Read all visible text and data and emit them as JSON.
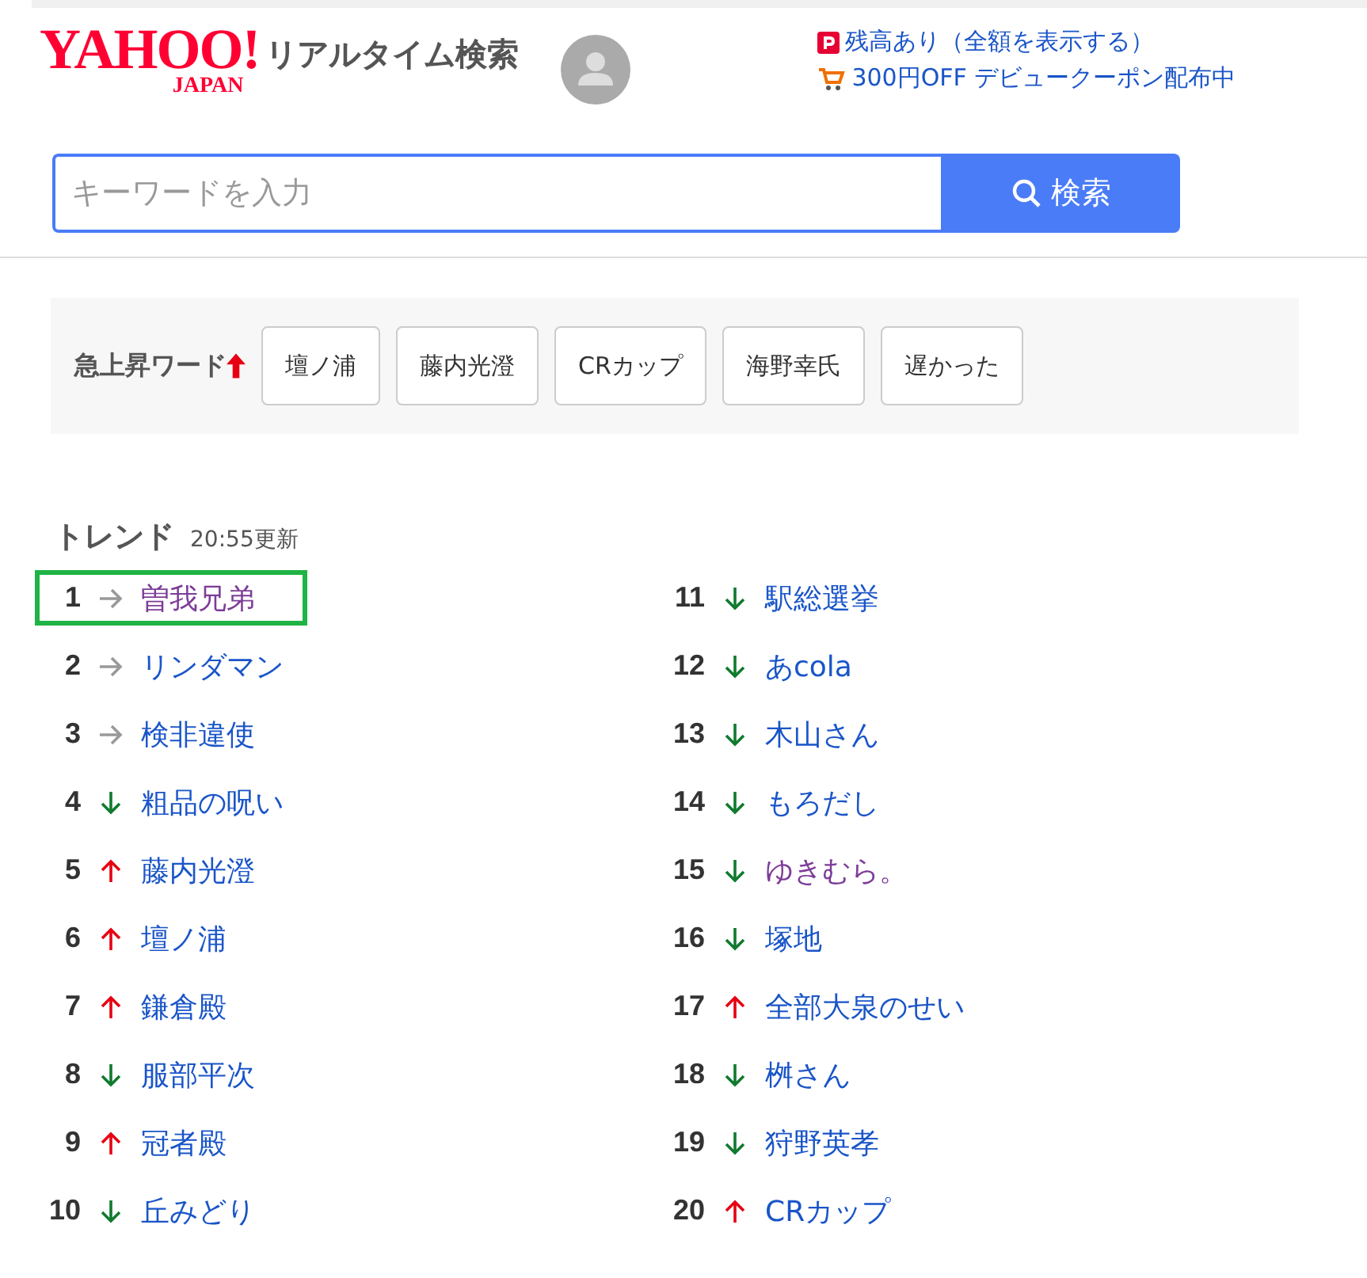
{
  "header": {
    "logo": {
      "main": "YAHOO!",
      "sub": "JAPAN"
    },
    "title": "リアルタイム検索",
    "points_link": "残高あり（全額を表示する）",
    "coupon_link": "300円OFF デビュークーポン配布中"
  },
  "search": {
    "placeholder": "キーワードを入力",
    "button": "検索"
  },
  "surge": {
    "label": "急上昇ワード",
    "words": [
      "壇ノ浦",
      "藤内光澄",
      "CRカップ",
      "海野幸氏",
      "遅かった"
    ]
  },
  "trend": {
    "title": "トレンド",
    "updated": "20:55更新",
    "items": [
      {
        "rank": "1",
        "kind": "flat",
        "word": "曽我兄弟",
        "visited": true,
        "selected": true
      },
      {
        "rank": "2",
        "kind": "flat",
        "word": "リンダマン",
        "visited": false,
        "selected": false
      },
      {
        "rank": "3",
        "kind": "flat",
        "word": "検非違使",
        "visited": false,
        "selected": false
      },
      {
        "rank": "4",
        "kind": "down",
        "word": "粗品の呪い",
        "visited": false,
        "selected": false
      },
      {
        "rank": "5",
        "kind": "up",
        "word": "藤内光澄",
        "visited": false,
        "selected": false
      },
      {
        "rank": "6",
        "kind": "up",
        "word": "壇ノ浦",
        "visited": false,
        "selected": false
      },
      {
        "rank": "7",
        "kind": "up",
        "word": "鎌倉殿",
        "visited": false,
        "selected": false
      },
      {
        "rank": "8",
        "kind": "down",
        "word": "服部平次",
        "visited": false,
        "selected": false
      },
      {
        "rank": "9",
        "kind": "up",
        "word": "冠者殿",
        "visited": false,
        "selected": false
      },
      {
        "rank": "10",
        "kind": "down",
        "word": "丘みどり",
        "visited": false,
        "selected": false
      },
      {
        "rank": "11",
        "kind": "down",
        "word": "駅総選挙",
        "visited": false,
        "selected": false
      },
      {
        "rank": "12",
        "kind": "down",
        "word": "あcola",
        "visited": false,
        "selected": false
      },
      {
        "rank": "13",
        "kind": "down",
        "word": "木山さん",
        "visited": false,
        "selected": false
      },
      {
        "rank": "14",
        "kind": "down",
        "word": "もろだし",
        "visited": false,
        "selected": false
      },
      {
        "rank": "15",
        "kind": "down",
        "word": "ゆきむら。",
        "visited": true,
        "selected": false
      },
      {
        "rank": "16",
        "kind": "down",
        "word": "塚地",
        "visited": false,
        "selected": false
      },
      {
        "rank": "17",
        "kind": "up",
        "word": "全部大泉のせい",
        "visited": false,
        "selected": false
      },
      {
        "rank": "18",
        "kind": "down",
        "word": "桝さん",
        "visited": false,
        "selected": false
      },
      {
        "rank": "19",
        "kind": "down",
        "word": "狩野英孝",
        "visited": false,
        "selected": false
      },
      {
        "rank": "20",
        "kind": "up",
        "word": "CRカップ",
        "visited": false,
        "selected": false
      }
    ]
  }
}
